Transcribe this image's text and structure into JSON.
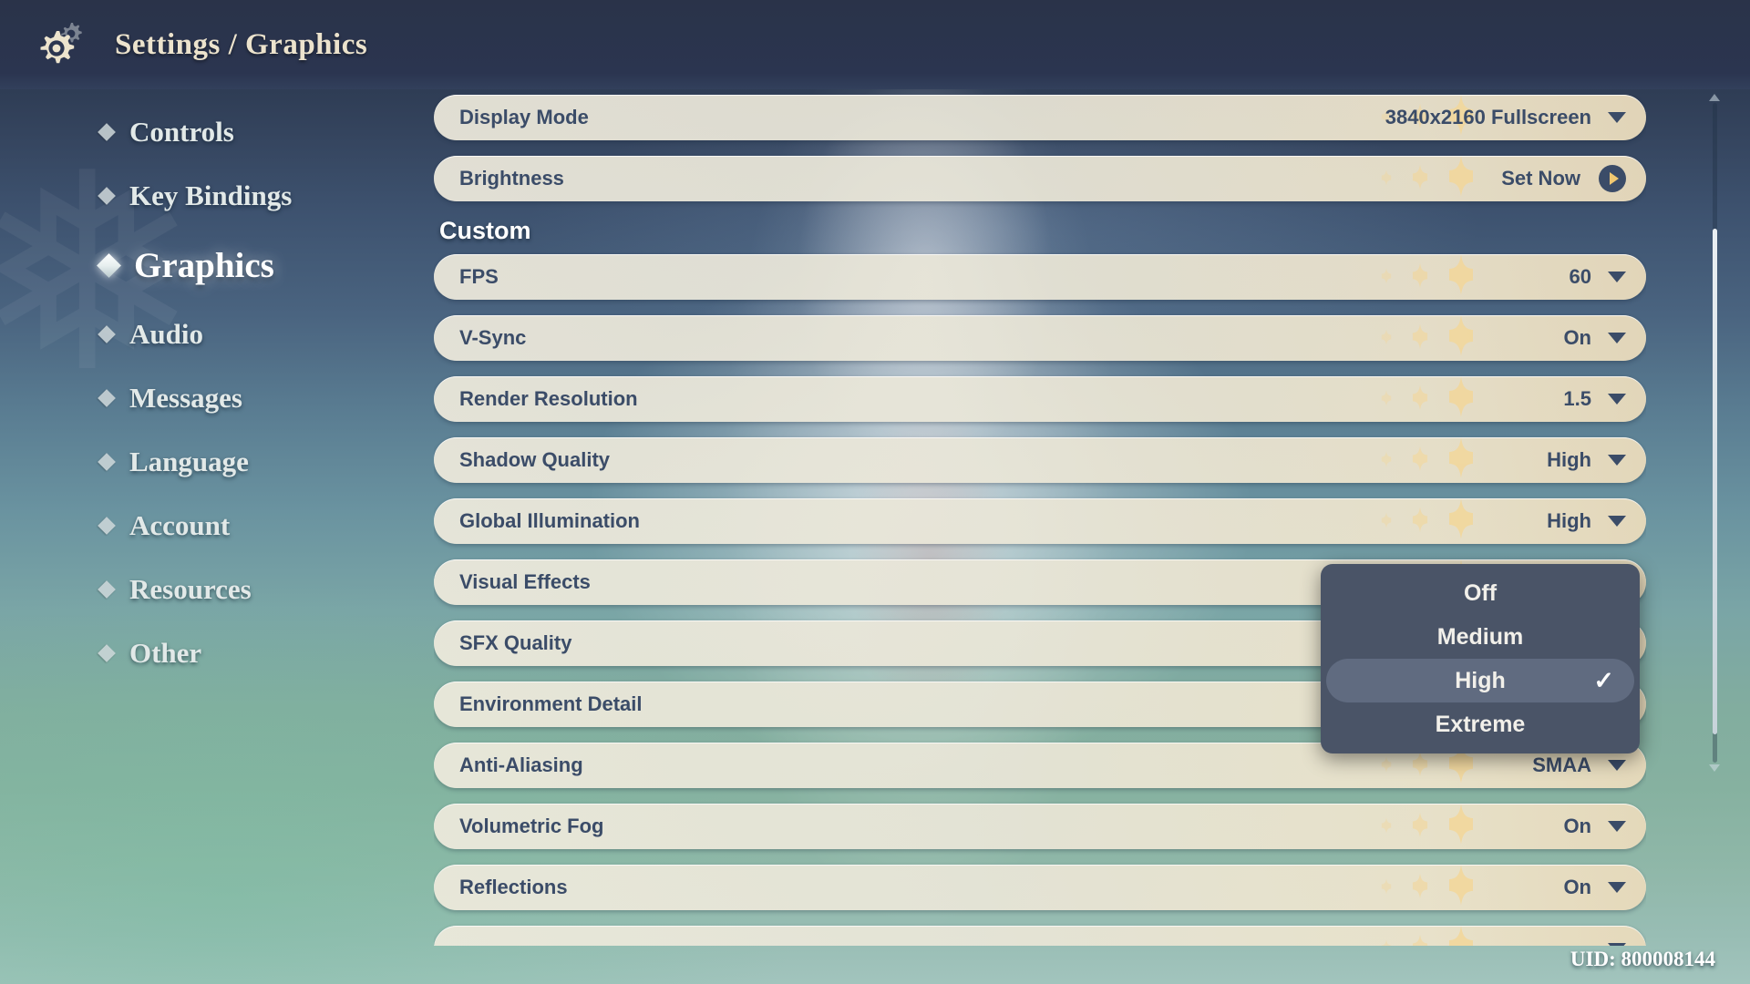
{
  "header": {
    "title": "Settings / Graphics",
    "gear_icon": "gear-icon",
    "close_icon": "close-icon"
  },
  "sidebar": {
    "items": [
      {
        "label": "Controls",
        "active": false
      },
      {
        "label": "Key Bindings",
        "active": false
      },
      {
        "label": "Graphics",
        "active": true
      },
      {
        "label": "Audio",
        "active": false
      },
      {
        "label": "Messages",
        "active": false
      },
      {
        "label": "Language",
        "active": false
      },
      {
        "label": "Account",
        "active": false
      },
      {
        "label": "Resources",
        "active": false
      },
      {
        "label": "Other",
        "active": false
      }
    ]
  },
  "main": {
    "top_rows": [
      {
        "label": "Display Mode",
        "value": "3840x2160 Fullscreen",
        "control": "dropdown"
      },
      {
        "label": "Brightness",
        "value": "Set Now",
        "control": "action"
      }
    ],
    "section_title": "Custom",
    "custom_rows": [
      {
        "label": "FPS",
        "value": "60",
        "control": "dropdown"
      },
      {
        "label": "V-Sync",
        "value": "On",
        "control": "dropdown"
      },
      {
        "label": "Render Resolution",
        "value": "1.5",
        "control": "dropdown"
      },
      {
        "label": "Shadow Quality",
        "value": "High",
        "control": "dropdown"
      },
      {
        "label": "Global Illumination",
        "value": "High",
        "control": "dropdown"
      },
      {
        "label": "Visual Effects",
        "value": "",
        "control": "dropdown"
      },
      {
        "label": "SFX Quality",
        "value": "",
        "control": "dropdown"
      },
      {
        "label": "Environment Detail",
        "value": "",
        "control": "dropdown"
      },
      {
        "label": "Anti-Aliasing",
        "value": "SMAA",
        "control": "dropdown"
      },
      {
        "label": "Volumetric Fog",
        "value": "On",
        "control": "dropdown"
      },
      {
        "label": "Reflections",
        "value": "On",
        "control": "dropdown"
      },
      {
        "label": "",
        "value": "",
        "control": "dropdown"
      }
    ]
  },
  "dropdown": {
    "open": true,
    "options": [
      {
        "label": "Off",
        "selected": false
      },
      {
        "label": "Medium",
        "selected": false
      },
      {
        "label": "High",
        "selected": true
      },
      {
        "label": "Extreme",
        "selected": false
      }
    ],
    "check_glyph": "✓"
  },
  "footer": {
    "uid": "UID: 800008144"
  },
  "colors": {
    "topbar": "#2b3550",
    "row_bg": "#ece9da",
    "row_text": "#3b4c68",
    "title_text": "#ece3cd",
    "dropdown_bg": "#4a5467",
    "dropdown_selected": "#606b80",
    "accent_gold": "#f0c871"
  }
}
